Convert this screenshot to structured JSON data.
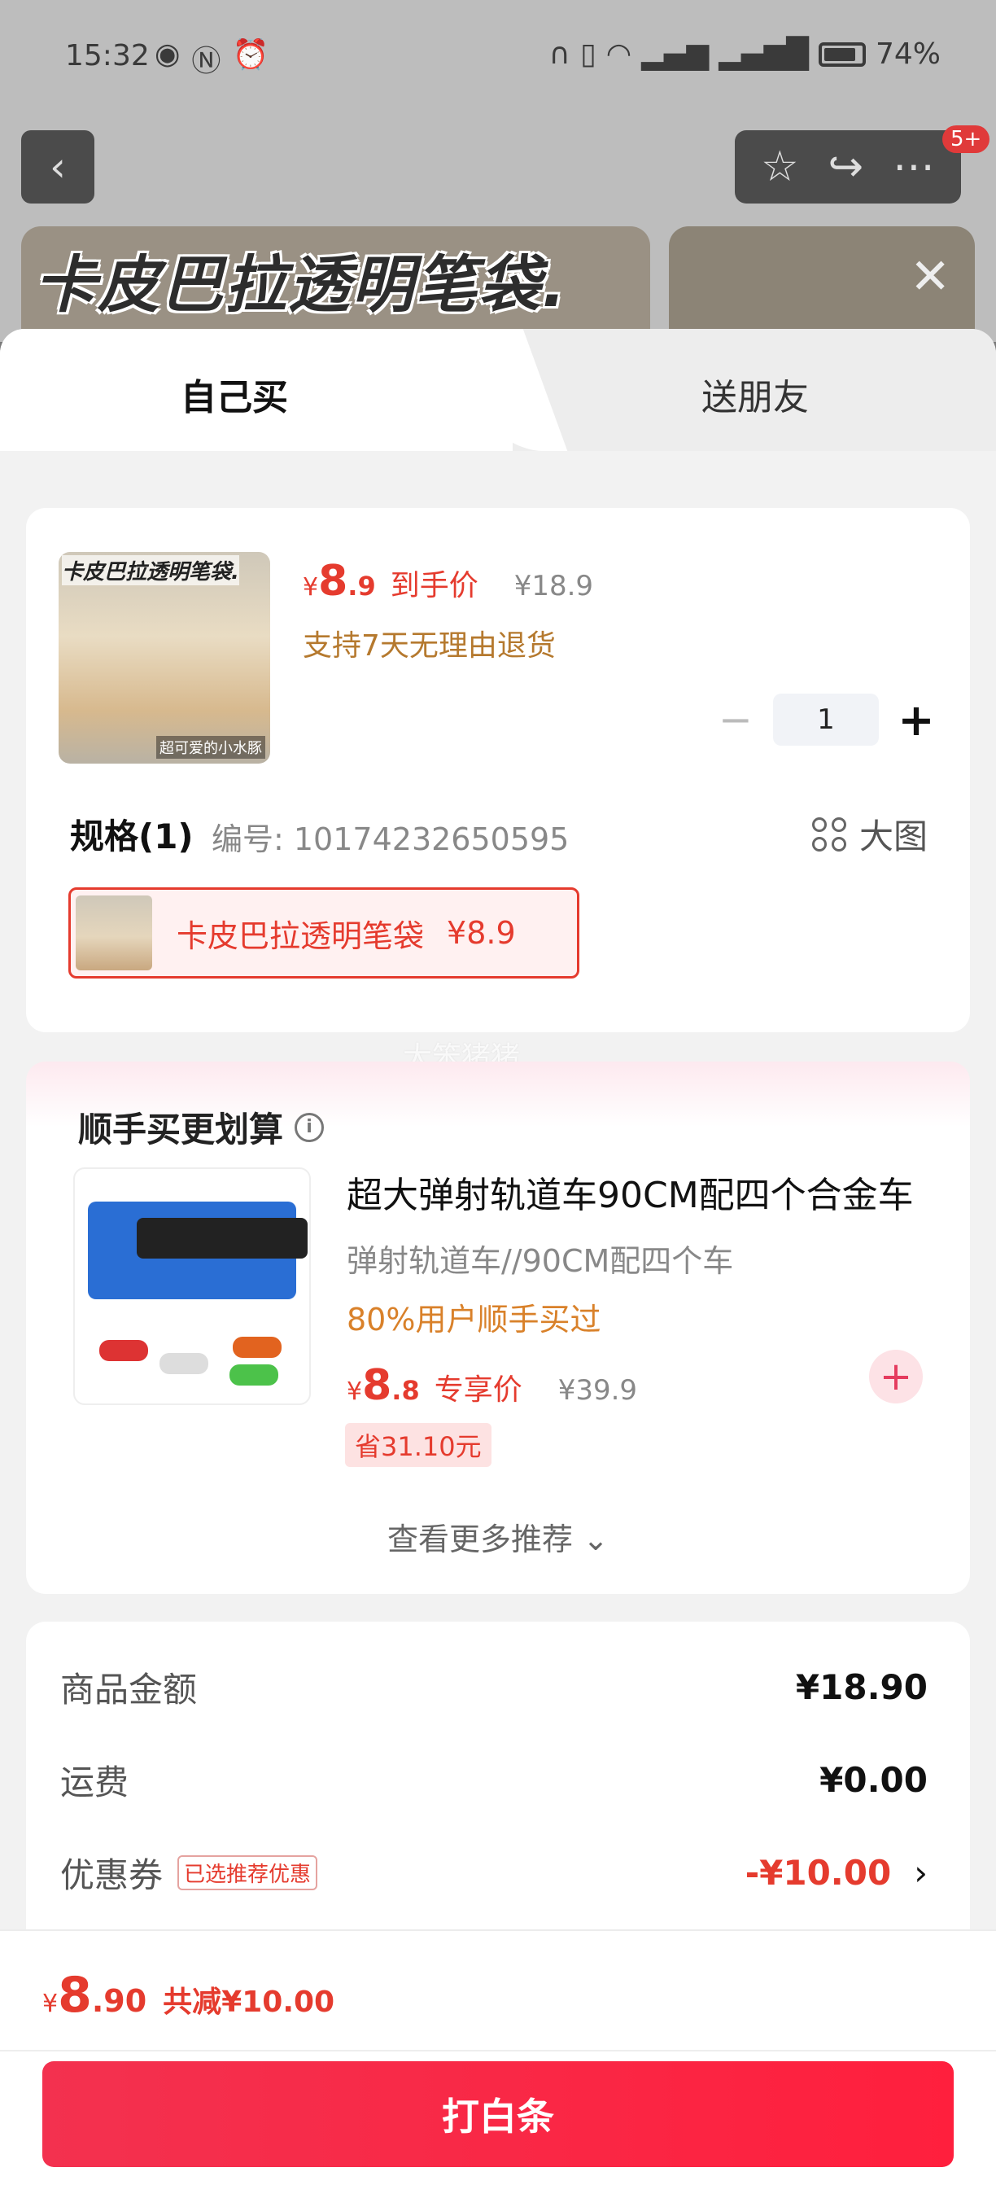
{
  "status_bar": {
    "time": "15:32",
    "battery": "74%",
    "icons": [
      "eye-icon",
      "nfc-icon",
      "alarm-icon",
      "headphones-icon",
      "battery-saver-icon",
      "wifi-icon",
      "signal-4g-icon",
      "signal-5g-icon"
    ]
  },
  "product_page": {
    "banner_title": "卡皮巴拉透明笔袋.",
    "notification_badge": "5+"
  },
  "tabs": {
    "self": "自己买",
    "gift": "送朋友"
  },
  "product": {
    "thumb_title": "卡皮巴拉透明笔袋.",
    "thumb_caption": "超可爱的小水豚",
    "price_symbol": "¥",
    "price_int": "8",
    "price_dec": ".9",
    "price_tag": "到手价",
    "original_price": "¥18.9",
    "return_policy": "支持7天无理由退货",
    "quantity": "1",
    "spec_title": "规格(1)",
    "spec_code": "编号: 10174232650595",
    "big_pic_label": "大图",
    "sku_name": "卡皮巴拉透明笔袋",
    "sku_price": "¥8.9"
  },
  "watermark": "大笨猪猪",
  "recommend": {
    "title": "顺手买更划算",
    "item_name": "超大弹射轨道车90CM配四个合金车",
    "item_sub": "弹射轨道车//90CM配四个车",
    "item_stat": "80%用户顺手买过",
    "price_symbol": "¥",
    "price_int": "8",
    "price_dec": ".8",
    "price_tag": "专享价",
    "original_price": "¥39.9",
    "save": "省31.10元",
    "more": "查看更多推荐 ⌄"
  },
  "summary": {
    "goods_label": "商品金额",
    "goods_value": "¥18.90",
    "shipping_label": "运费",
    "shipping_value": "¥0.00",
    "coupon_label": "优惠券",
    "coupon_badge": "已选推荐优惠",
    "coupon_value": "-¥10.00"
  },
  "checkout": {
    "price_symbol": "¥",
    "total_int": "8",
    "total_dec": ".90",
    "discount": "共减¥10.00",
    "pay_button": "打白条"
  },
  "colors": {
    "accent_red": "#e53b2e",
    "pay_button": "#ff1f3d",
    "coupon_note": "#b5792e",
    "stat_orange": "#d9812a"
  }
}
